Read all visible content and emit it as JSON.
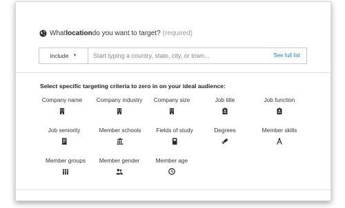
{
  "location": {
    "question_prefix": "What ",
    "question_bold": "location",
    "question_suffix": " do you want to target?",
    "required_label": "(required)",
    "include_label": "include",
    "input_placeholder": "Start typing a country, state, city, or town...",
    "see_full_list": "See full list"
  },
  "criteria": {
    "heading": "Select specific targeting criteria to zero in on your ideal audience:",
    "items": [
      {
        "label": "Company name",
        "icon": "building-icon"
      },
      {
        "label": "Company industry",
        "icon": "building-icon"
      },
      {
        "label": "Company size",
        "icon": "building-icon"
      },
      {
        "label": "Job title",
        "icon": "badge-icon"
      },
      {
        "label": "Job function",
        "icon": "badge-icon"
      },
      {
        "label": "Job seniority",
        "icon": "document-icon"
      },
      {
        "label": "Member schools",
        "icon": "school-icon"
      },
      {
        "label": "Fields of study",
        "icon": "book-icon"
      },
      {
        "label": "Degrees",
        "icon": "diploma-icon"
      },
      {
        "label": "Member skills",
        "icon": "compass-icon"
      },
      {
        "label": "Member groups",
        "icon": "group-icon"
      },
      {
        "label": "Member gender",
        "icon": "people-icon"
      },
      {
        "label": "Member age",
        "icon": "clock-icon"
      }
    ]
  },
  "colors": {
    "link": "#1d7fb8",
    "icon": "#2b2b2b"
  }
}
